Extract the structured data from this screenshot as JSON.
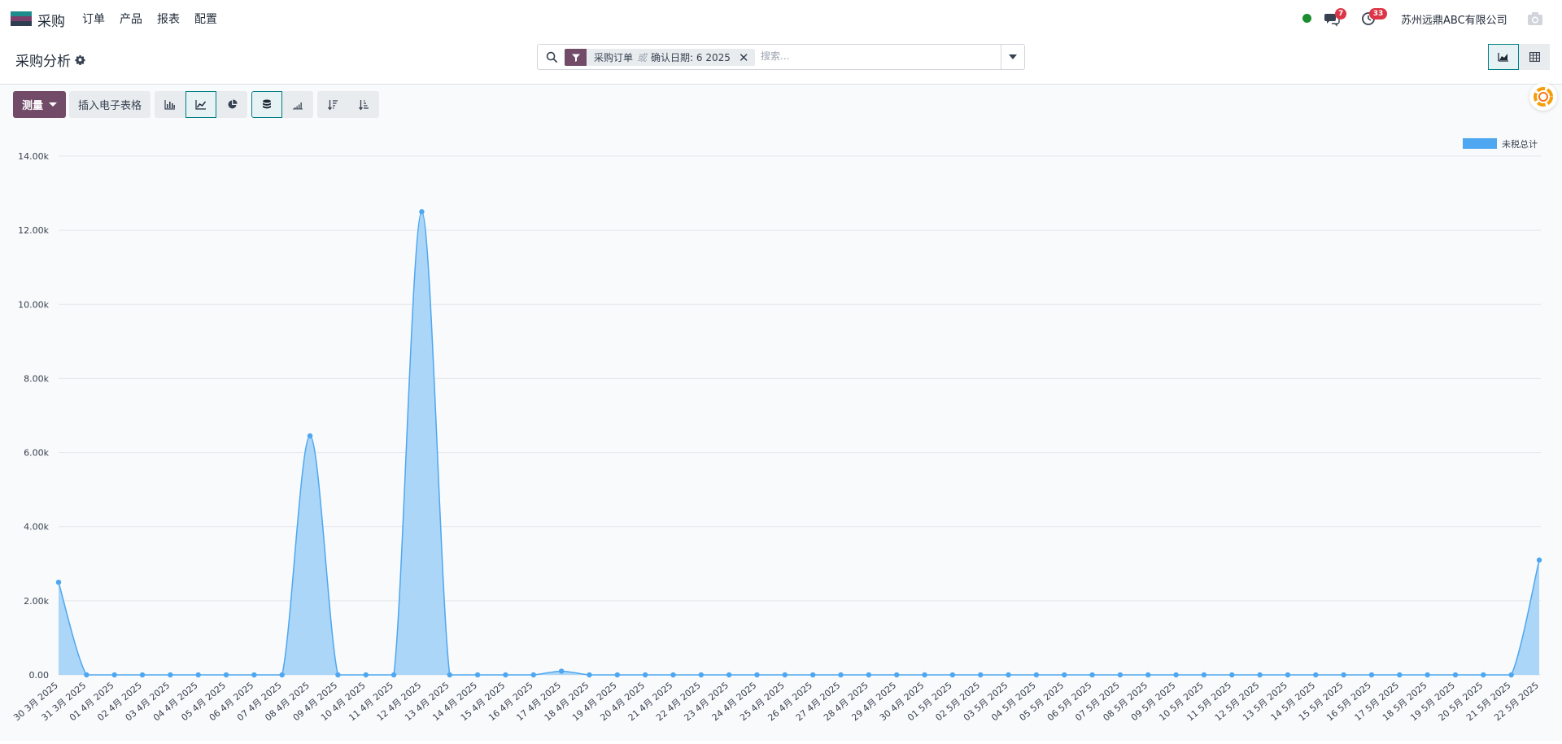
{
  "app": {
    "name": "采购"
  },
  "nav": {
    "items": [
      "订单",
      "产品",
      "报表",
      "配置"
    ]
  },
  "systray": {
    "messages_count": "7",
    "activities_count": "33",
    "company": "苏州远鼎ABC有限公司"
  },
  "page": {
    "title": "采购分析"
  },
  "search": {
    "facet_part1": "采购订单",
    "facet_or": "或",
    "facet_part2": "确认日期: 6 2025",
    "placeholder": "搜索..."
  },
  "toolbar": {
    "measure_label": "测量",
    "insert_sheet_label": "插入电子表格"
  },
  "colors": {
    "accent": "#714b67",
    "teal": "#017e84",
    "series": "#4ea7f0",
    "series_fill": "#a6d4f8"
  },
  "chart_data": {
    "type": "area",
    "legend": [
      "未税总计"
    ],
    "legend_position": "top-right",
    "grid": true,
    "y_ticks": [
      "0.00",
      "2.00k",
      "4.00k",
      "6.00k",
      "8.00k",
      "10.00k",
      "12.00k",
      "14.00k"
    ],
    "ylim": [
      0,
      14000
    ],
    "categories": [
      "30 3月 2025",
      "31 3月 2025",
      "01 4月 2025",
      "02 4月 2025",
      "03 4月 2025",
      "04 4月 2025",
      "05 4月 2025",
      "06 4月 2025",
      "07 4月 2025",
      "08 4月 2025",
      "09 4月 2025",
      "10 4月 2025",
      "11 4月 2025",
      "12 4月 2025",
      "13 4月 2025",
      "14 4月 2025",
      "15 4月 2025",
      "16 4月 2025",
      "17 4月 2025",
      "18 4月 2025",
      "19 4月 2025",
      "20 4月 2025",
      "21 4月 2025",
      "22 4月 2025",
      "23 4月 2025",
      "24 4月 2025",
      "25 4月 2025",
      "26 4月 2025",
      "27 4月 2025",
      "28 4月 2025",
      "29 4月 2025",
      "30 4月 2025",
      "01 5月 2025",
      "02 5月 2025",
      "03 5月 2025",
      "04 5月 2025",
      "05 5月 2025",
      "06 5月 2025",
      "07 5月 2025",
      "08 5月 2025",
      "09 5月 2025",
      "10 5月 2025",
      "11 5月 2025",
      "12 5月 2025",
      "13 5月 2025",
      "14 5月 2025",
      "15 5月 2025",
      "16 5月 2025",
      "17 5月 2025",
      "18 5月 2025",
      "19 5月 2025",
      "20 5月 2025",
      "21 5月 2025",
      "22 5月 2025"
    ],
    "series": [
      {
        "name": "未税总计",
        "values": [
          2500,
          0,
          0,
          0,
          0,
          0,
          0,
          0,
          0,
          6450,
          0,
          0,
          0,
          12500,
          0,
          0,
          0,
          0,
          100,
          0,
          0,
          0,
          0,
          0,
          0,
          0,
          0,
          0,
          0,
          0,
          0,
          0,
          0,
          0,
          0,
          0,
          0,
          0,
          0,
          0,
          0,
          0,
          0,
          0,
          0,
          0,
          0,
          0,
          0,
          0,
          0,
          0,
          0,
          3100
        ]
      }
    ]
  }
}
